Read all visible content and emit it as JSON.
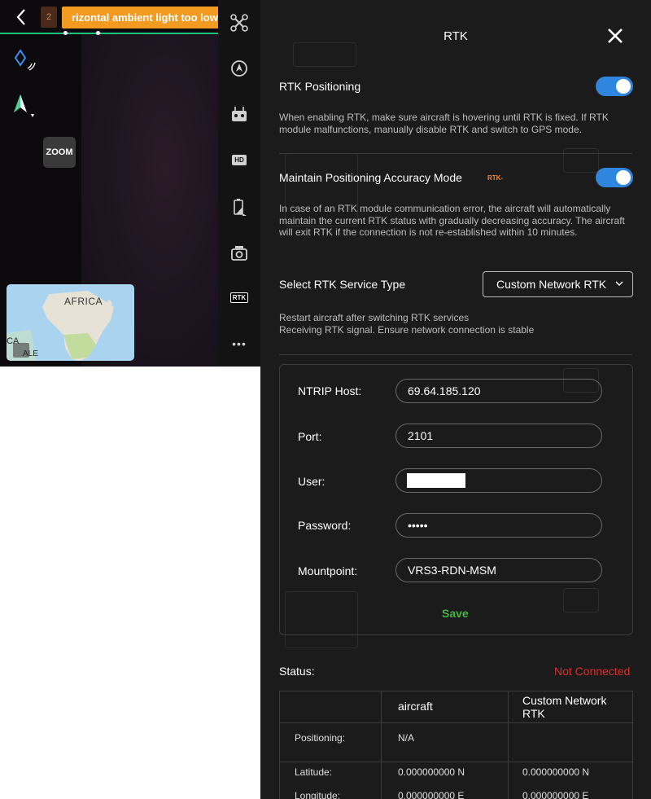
{
  "camera": {
    "notification_count": "2",
    "warning_text": "rizontal ambient light too low. Ho",
    "zoom_label": "ZOOM",
    "map": {
      "label": "AFRICA",
      "corner_text_1": "CA",
      "corner_text_2": "ALE"
    }
  },
  "sidebar": {
    "icons": [
      "aircraft-icon",
      "flight-mode-icon",
      "remote-controller-icon",
      "hd-icon",
      "battery-icon",
      "camera-icon",
      "rtk-icon",
      "more-icon"
    ],
    "hd_text": "HD",
    "rtk_text": "RTK",
    "more_text": "•••"
  },
  "panel": {
    "title": "RTK",
    "rtk_positioning": {
      "label": "RTK Positioning",
      "enabled": true,
      "description": "When enabling RTK, make sure aircraft is hovering until RTK is fixed. If RTK module malfunctions, manually disable RTK and switch to GPS mode."
    },
    "accuracy_mode": {
      "label": "Maintain Positioning Accuracy Mode",
      "badge": "RTK-",
      "enabled": true,
      "description": "In case of an RTK module communication error, the aircraft will automatically maintain the current RTK status with gradually decreasing accuracy. The aircraft will exit RTK if the connection is not re-established within 10 minutes."
    },
    "service_type": {
      "label": "Select RTK Service Type",
      "selected": "Custom Network RTK",
      "note_line_1": "Restart aircraft after switching RTK services",
      "note_line_2": "Receiving RTK signal. Ensure network connection is stable"
    },
    "form": {
      "host_label": "NTRIP Host:",
      "host_value": "69.64.185.120",
      "port_label": "Port:",
      "port_value": "2101",
      "user_label": "User:",
      "user_value": "",
      "password_label": "Password:",
      "password_value": "•••••",
      "mountpoint_label": "Mountpoint:",
      "mountpoint_value": "VRS3-RDN-MSM",
      "save_label": "Save"
    },
    "status": {
      "label": "Status:",
      "value": "Not Connected",
      "status_color": "#d9302c"
    },
    "table": {
      "col_aircraft": "aircraft",
      "col_network_1": "Custom Network",
      "col_network_2": "RTK",
      "rows": [
        {
          "label": "Positioning:",
          "aircraft": "N/A",
          "network": ""
        },
        {
          "label": "Latitude:",
          "aircraft": "0.000000000 N",
          "network": "0.000000000 N"
        },
        {
          "label": "Longitude:",
          "aircraft": "0.000000000 E",
          "network": "0.000000000 E"
        }
      ]
    }
  },
  "colors": {
    "accent": "#2e86de",
    "warning": "#f39a21",
    "save": "#43b443",
    "badge": "#e8893a"
  }
}
